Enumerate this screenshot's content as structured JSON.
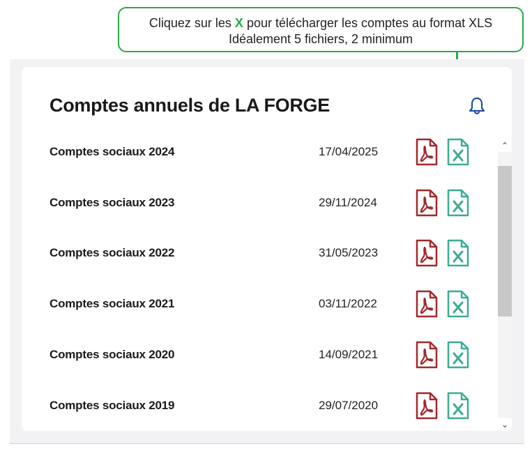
{
  "tooltip": {
    "line1_before": "Cliquez sur les ",
    "line1_x": "X",
    "line1_after": " pour télécharger les comptes au format XLS",
    "line2": "Idéalement 5 fichiers, 2 minimum"
  },
  "card": {
    "title": "Comptes annuels de LA FORGE"
  },
  "icons": {
    "bell": "bell-icon",
    "pdf": "pdf-file-icon",
    "xls": "excel-file-icon"
  },
  "colors": {
    "accent_green": "#2aa84a",
    "pdf_red": "#a3282b",
    "xls_teal": "#3bab94",
    "bell_blue": "#1f4fa0"
  },
  "rows": [
    {
      "label": "Comptes sociaux 2024",
      "date": "17/04/2025"
    },
    {
      "label": "Comptes sociaux 2023",
      "date": "29/11/2024"
    },
    {
      "label": "Comptes sociaux 2022",
      "date": "31/05/2023"
    },
    {
      "label": "Comptes sociaux 2021",
      "date": "03/11/2022"
    },
    {
      "label": "Comptes sociaux 2020",
      "date": "14/09/2021"
    },
    {
      "label": "Comptes sociaux 2019",
      "date": "29/07/2020"
    }
  ],
  "scrollbar": {
    "up": "⌃",
    "down": "⌄"
  }
}
